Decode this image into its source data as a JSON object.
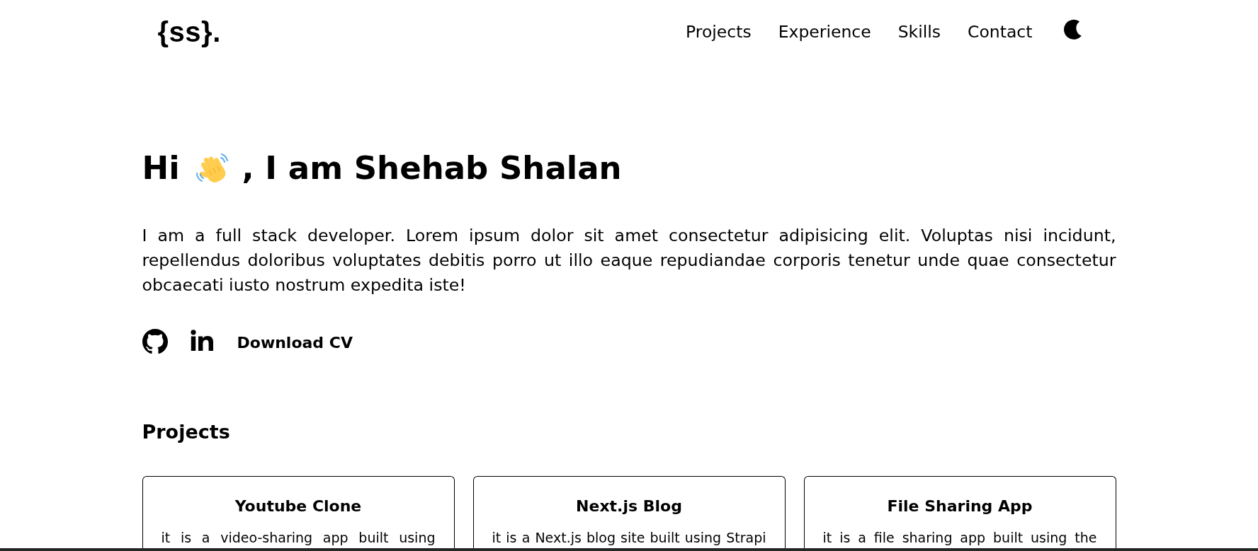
{
  "header": {
    "logo": "{ss}.",
    "nav": [
      {
        "label": "Projects"
      },
      {
        "label": "Experience"
      },
      {
        "label": "Skills"
      },
      {
        "label": "Contact"
      }
    ]
  },
  "hero": {
    "greeting": "Hi",
    "title_rest": ", I am Shehab Shalan",
    "intro": "I am a full stack developer. Lorem ipsum dolor sit amet consectetur adipisicing elit. Voluptas nisi incidunt, repellendus doloribus voluptates debitis porro ut illo eaque repudiandae corporis tenetur unde quae consectetur obcaecati iusto nostrum expedita iste!",
    "download_cv": "Download CV"
  },
  "projects": {
    "heading": "Projects",
    "cards": [
      {
        "title": "Youtube Clone",
        "description": "it is a video-sharing app built using"
      },
      {
        "title": "Next.js Blog",
        "description": "it is a Next.js blog site built using Strapi"
      },
      {
        "title": "File Sharing App",
        "description": "it is a file sharing app built using the"
      }
    ]
  }
}
